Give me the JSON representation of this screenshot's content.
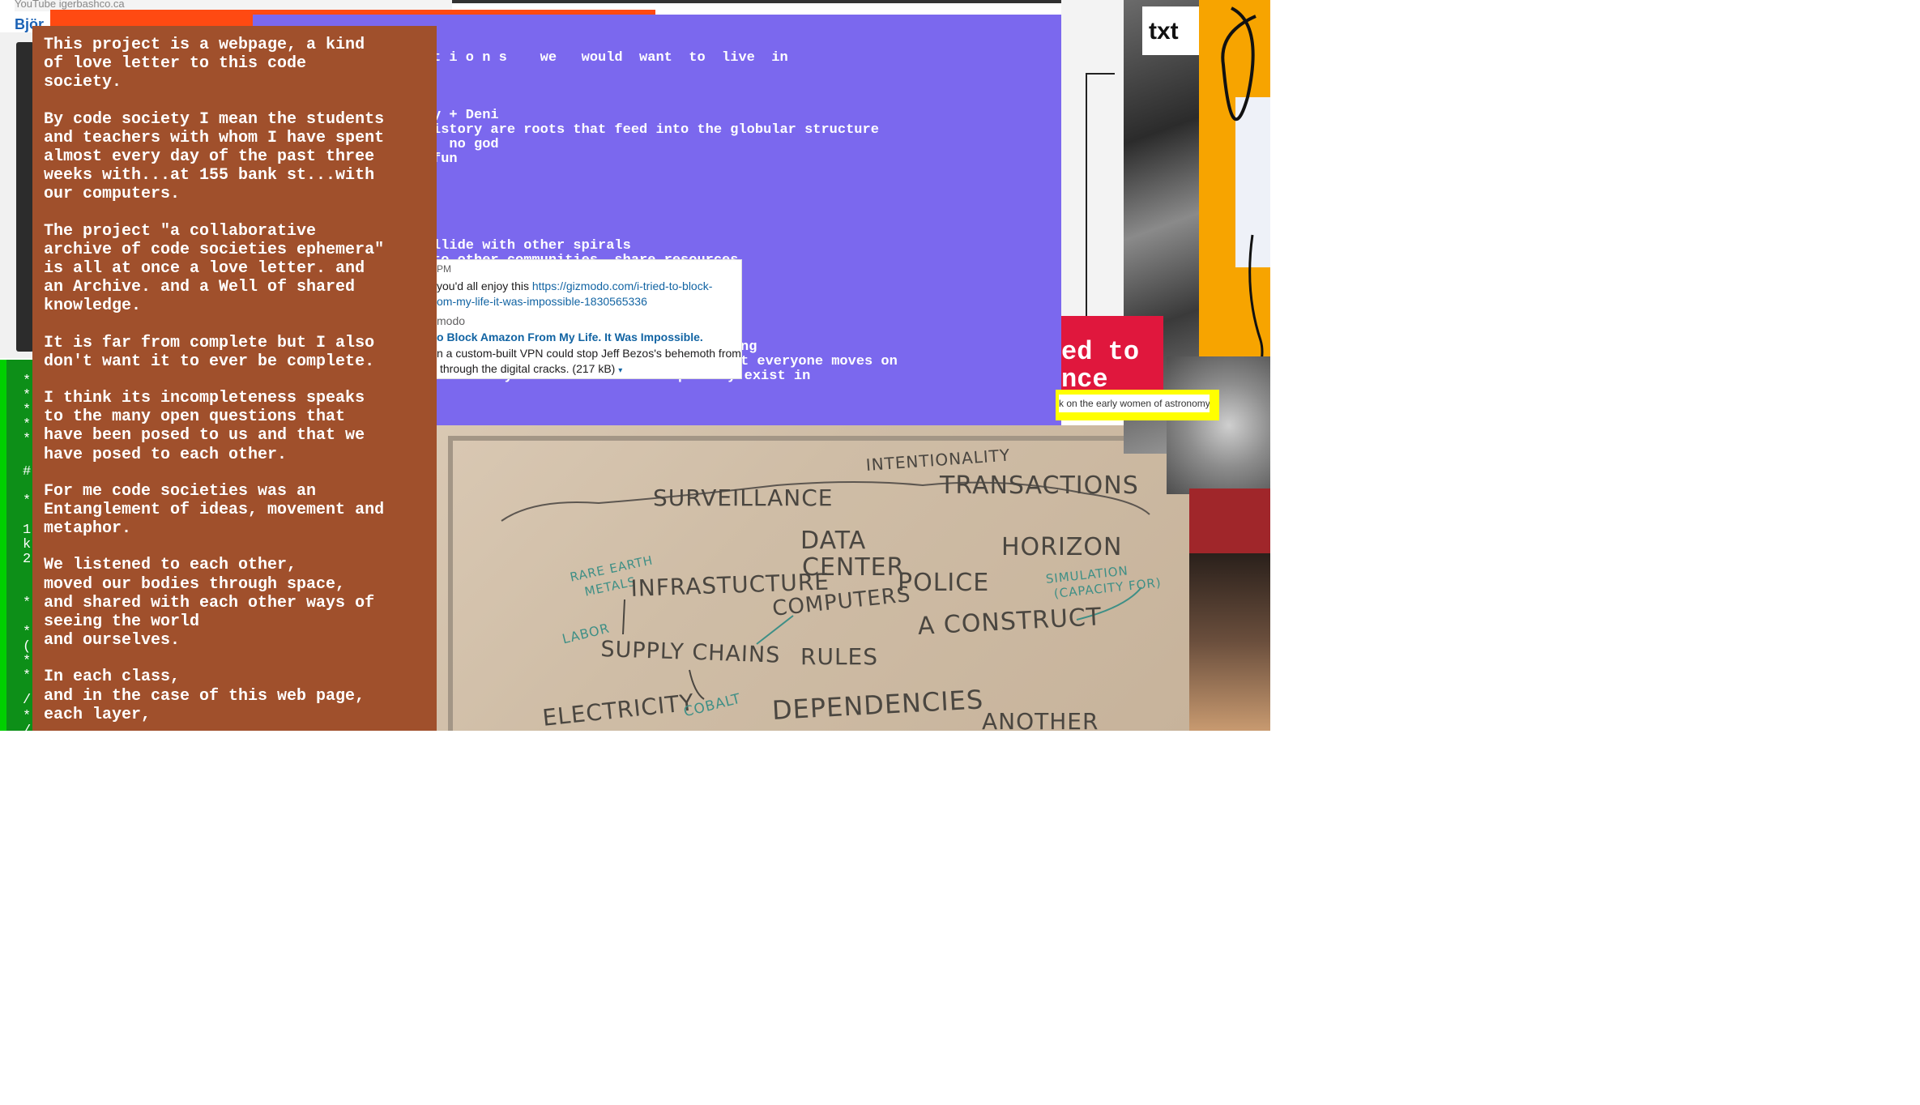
{
  "top": {
    "youtube_fragment": "YouTube  igerbashco.ca",
    "browser_user": "Björ"
  },
  "terminal": {
    "lines": [
      "*",
      "*",
      "*",
      "*",
      "*",
      "#",
      "*",
      "1",
      "k",
      "2",
      "*",
      "*",
      "(",
      "*",
      "*",
      "/",
      "*",
      "/"
    ]
  },
  "purple": {
    "lines": [
      "t i o n s    we   would  want  to  live  in",
      "y + Deni",
      "istory are roots that feed into the globular structure",
      "  no god",
      "fun",
      "llide with other spirals",
      "to other communities  share resources",
      "ng",
      "t everyone moves on",
      "everyone created  the shape they exist in"
    ]
  },
  "popup": {
    "time": "PM",
    "message": "you'd all enjoy this",
    "url_part1": "https://gizmodo.com/i-tried-to-block-",
    "url_part2": "om-my-life-it-was-impossible-1830565336",
    "source": "modo",
    "link_title": "o Block Amazon From My Life. It Was Impossible.",
    "description": "n a custom-built VPN could stop Jeff Bezos's behemoth from",
    "description2": "through the digital cracks. (217 kB)",
    "caret": "▾"
  },
  "essay": {
    "paragraphs": [
      "This project is a webpage, a kind\nof love letter to this code\nsociety.",
      "By code society I mean the students\nand teachers with whom I have spent\nalmost every day of the past three\nweeks with...at 155 bank st...with\nour computers.",
      "The project \"a collaborative\narchive of code societies ephemera\"\nis all at once a love letter. and\nan Archive. and a Well of shared\nknowledge.",
      "It is far from complete but I also\ndon't want it to ever be complete.",
      "I think its incompleteness speaks\nto the many open questions that\nhave been posed to us and that we\nhave posed to each other.",
      "For me code societies was an\nEntanglement of ideas, movement and\nmetaphor.",
      "We listened to each other,\nmoved our bodies through space,\nand shared with each other ways of\nseeing the world\nand ourselves.",
      "In each class,\nand in the case of this web page,\neach layer,"
    ]
  },
  "whiteboard": {
    "words": {
      "intentionality": "INTENTIONALITY",
      "transactions": "TRANSACTIONS",
      "surveillance": "SURVEILLANCE",
      "data": "DATA",
      "center": "CENTER",
      "horizon": "HORIZON",
      "rare_earth": "RARE EARTH",
      "metals": "METALS",
      "infrastructure": "INFRASTUCTURE",
      "police": "POLICE",
      "simulation": "SIMULATION",
      "capacity": "(CAPACITY FOR)",
      "computers": "COMPUTERS",
      "labor": "LABOR",
      "a_construct": "A  CONSTRUCT",
      "supply_chains": "SUPPLY CHAINS",
      "rules": "RULES",
      "electricity": "ELECTRICITY",
      "cobalt": "COBALT",
      "dependencies": "DEPENDENCIES",
      "another": "ANOTHER"
    }
  },
  "right": {
    "txt_label": "txt",
    "red_line1": "ed to",
    "red_line2": "nce",
    "yellow_text": "k on the early women of astronomy"
  },
  "colors": {
    "purple": "#7b68ee",
    "brown": "#a0502c",
    "orange": "#ff4a12",
    "green": "#0d8f18",
    "red": "#e0173d",
    "yellow": "#ffff00",
    "amber": "#f7a400"
  }
}
